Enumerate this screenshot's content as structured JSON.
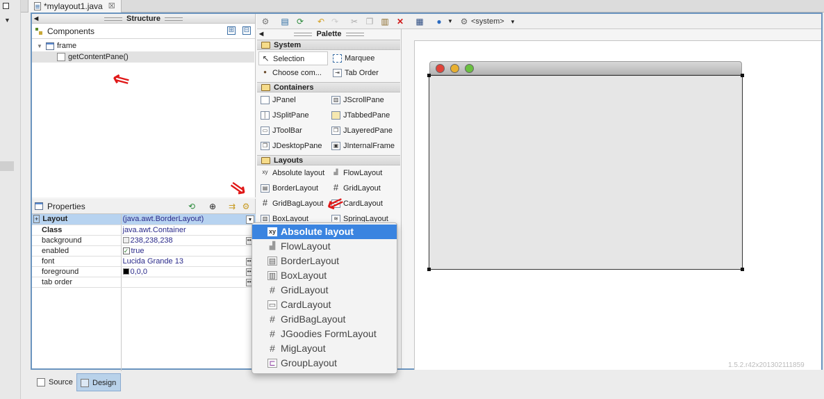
{
  "editor": {
    "tab_title": "*mylayout1.java",
    "close_glyph": "☒"
  },
  "structure": {
    "title": "Structure",
    "components_label": "Components",
    "expand_glyph": "⊞",
    "collapse_glyph": "⊟",
    "tree": [
      {
        "label": "frame"
      },
      {
        "label": "getContentPane()"
      }
    ]
  },
  "properties": {
    "title": "Properties",
    "rows": [
      {
        "name": "Layout",
        "value": "(java.awt.BorderLayout)"
      },
      {
        "name": "Class",
        "value": "java.awt.Container"
      },
      {
        "name": "background",
        "value": "238,238,238"
      },
      {
        "name": "enabled",
        "value": "true"
      },
      {
        "name": "font",
        "value": "Lucida Grande 13"
      },
      {
        "name": "foreground",
        "value": "0,0,0"
      },
      {
        "name": "tab order",
        "value": ""
      }
    ],
    "colors": {
      "background_swatch": "#eeeeee",
      "foreground_swatch": "#000000"
    }
  },
  "toolbar": {
    "system_label": "<system>",
    "icons": [
      "test-icon",
      "preview-icon",
      "refresh-icon",
      "undo-icon",
      "redo-icon",
      "cut-icon",
      "copy-icon",
      "paste-icon",
      "delete-icon",
      "form-icon",
      "globe-icon",
      "system-look-icon"
    ]
  },
  "palette": {
    "title": "Palette",
    "categories": {
      "system": "System",
      "containers": "Containers",
      "layouts": "Layouts"
    },
    "system_items": [
      "Selection",
      "Marquee",
      "Choose com...",
      "Tab Order"
    ],
    "container_items": [
      "JPanel",
      "JScrollPane",
      "JSplitPane",
      "JTabbedPane",
      "JToolBar",
      "JLayeredPane",
      "JDesktopPane",
      "JInternalFrame"
    ],
    "layout_items": [
      "Absolute layout",
      "FlowLayout",
      "BorderLayout",
      "GridLayout",
      "GridBagLayout",
      "CardLayout",
      "BoxLayout",
      "SpringLayout"
    ]
  },
  "layout_menu": {
    "items": [
      "Absolute layout",
      "FlowLayout",
      "BorderLayout",
      "BoxLayout",
      "GridLayout",
      "CardLayout",
      "GridBagLayout",
      "JGoodies FormLayout",
      "MigLayout",
      "GroupLayout"
    ],
    "highlighted": "Absolute layout"
  },
  "canvas": {
    "version": "1.5.2.r42x201302111859"
  },
  "bottom_tabs": {
    "source": "Source",
    "design": "Design"
  },
  "colors": {
    "accent": "#3a84e0",
    "frame_border": "#6a94bf",
    "selected_row": "#b7d3f0",
    "arrow": "#e01818",
    "traffic_red": "#e0443a",
    "traffic_yellow": "#e8b030",
    "traffic_green": "#6ac040"
  }
}
